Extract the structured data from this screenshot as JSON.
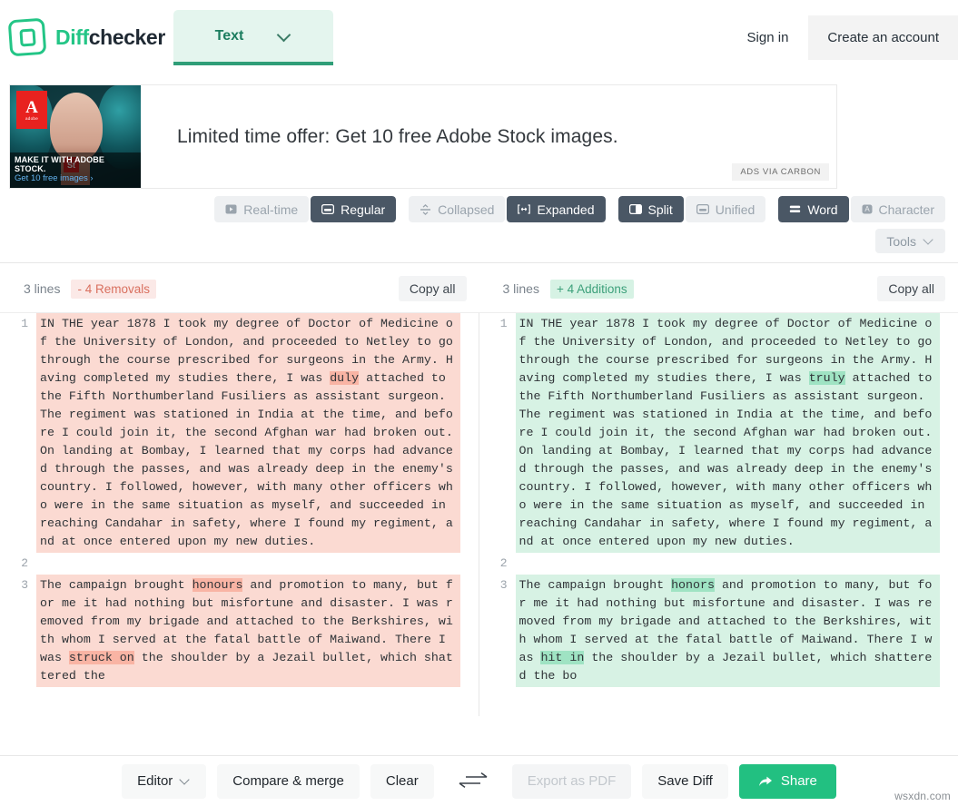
{
  "header": {
    "brand_first": "Diff",
    "brand_second": "checker",
    "type_tab_label": "Text",
    "sign_in": "Sign in",
    "create_account": "Create an account",
    "logo_icon": "diffchecker-logo-icon",
    "chevron_icon": "chevron-down-icon",
    "accent_color": "#23c586"
  },
  "ad": {
    "headline": "Limited time offer: Get 10 free Adobe Stock images.",
    "badge": "ADS VIA CARBON",
    "creative_line1": "MAKE IT WITH ADOBE STOCK.",
    "creative_line2": "Get 10 free images ›",
    "creative_logo": "A",
    "creative_logo_sub": "adobe",
    "creative_tag": "St"
  },
  "toolbar": {
    "groups": [
      {
        "name": "update-mode",
        "buttons": [
          {
            "label": "Real-time",
            "icon": "play-box-icon",
            "active": false
          },
          {
            "label": "Regular",
            "icon": "window-icon",
            "active": true
          }
        ]
      },
      {
        "name": "context-mode",
        "buttons": [
          {
            "label": "Collapsed",
            "icon": "collapse-icon",
            "active": false
          },
          {
            "label": "Expanded",
            "icon": "expand-icon",
            "active": true
          }
        ]
      },
      {
        "name": "layout-mode",
        "buttons": [
          {
            "label": "Split",
            "icon": "split-view-icon",
            "active": true
          },
          {
            "label": "Unified",
            "icon": "unified-view-icon",
            "active": false
          }
        ]
      },
      {
        "name": "granularity-mode",
        "buttons": [
          {
            "label": "Word",
            "icon": "word-diff-icon",
            "active": true
          },
          {
            "label": "Character",
            "icon": "character-diff-icon",
            "active": false
          }
        ]
      }
    ],
    "tools_label": "Tools",
    "tools_icon": "chevron-down-icon"
  },
  "stats": {
    "left": {
      "lines": "3 lines",
      "badge": "- 4 Removals",
      "copy_all": "Copy all"
    },
    "right": {
      "lines": "3 lines",
      "badge": "+ 4 Additions",
      "copy_all": "Copy all"
    }
  },
  "diff": {
    "left": [
      {
        "number": "1",
        "type": "del",
        "parts": [
          {
            "t": "IN THE year 1878 I took my degree of Doctor of Medicine of the University of London, and proceeded to Netley to go through the course prescribed for surgeons in the Army. Having completed my studies there, I was ",
            "hl": false
          },
          {
            "t": "duly",
            "hl": true
          },
          {
            "t": " attached to the Fifth Northumberland Fusiliers as assistant surgeon. The regiment was stationed in India at the time, and before I could join it, the second Afghan war had broken out. On landing at Bombay, I learned that my corps had advanced through the passes, and was already deep in the enemy's country. I followed, however, with many other officers who were in the same situation as myself, and succeeded in reaching Candahar in safety, where I found my regiment, and at once entered upon my new duties.",
            "hl": false
          }
        ]
      },
      {
        "number": "2",
        "type": "blank",
        "parts": []
      },
      {
        "number": "3",
        "type": "del",
        "parts": [
          {
            "t": "The campaign brought ",
            "hl": false
          },
          {
            "t": "honours",
            "hl": true
          },
          {
            "t": " and promotion to many, but for me it had nothing but misfortune and disaster. I was removed from my brigade and attached to the Berkshires, with whom I served at the fatal battle of Maiwand. There I was ",
            "hl": false
          },
          {
            "t": "struck on",
            "hl": true
          },
          {
            "t": " the shoulder by a Jezail bullet, which shattered the",
            "hl": false
          }
        ]
      }
    ],
    "right": [
      {
        "number": "1",
        "type": "ins",
        "parts": [
          {
            "t": "IN THE year 1878 I took my degree of Doctor of Medicine of the University of London, and proceeded to Netley to go through the course prescribed for surgeons in the Army. Having completed my studies there, I was ",
            "hl": false
          },
          {
            "t": "truly",
            "hl": true
          },
          {
            "t": " attached to the Fifth Northumberland Fusiliers as assistant surgeon. The regiment was stationed in India at the time, and before I could join it, the second Afghan war had broken out. On landing at Bombay, I learned that my corps had advanced through the passes, and was already deep in the enemy's country. I followed, however, with many other officers who were in the same situation as myself, and succeeded in reaching Candahar in safety, where I found my regiment, and at once entered upon my new duties.",
            "hl": false
          }
        ]
      },
      {
        "number": "2",
        "type": "blank",
        "parts": []
      },
      {
        "number": "3",
        "type": "ins",
        "parts": [
          {
            "t": "The campaign brought ",
            "hl": false
          },
          {
            "t": "honors",
            "hl": true
          },
          {
            "t": " and promotion to many, but for me it had nothing but misfortune and disaster. I was removed from my brigade and attached to the Berkshires, with whom I served at the fatal battle of Maiwand. There I was ",
            "hl": false
          },
          {
            "t": "hit in",
            "hl": true
          },
          {
            "t": " the shoulder by a Jezail bullet, which shattered the bo",
            "hl": false
          }
        ]
      }
    ]
  },
  "bottom": {
    "editor": "Editor",
    "editor_icon": "chevron-down-icon",
    "compare_merge": "Compare & merge",
    "clear": "Clear",
    "swap_icon": "swap-arrows-icon",
    "export_pdf": "Export as PDF",
    "save_diff": "Save Diff",
    "share": "Share",
    "share_icon": "share-arrow-icon"
  },
  "watermark": "wsxdn.com"
}
